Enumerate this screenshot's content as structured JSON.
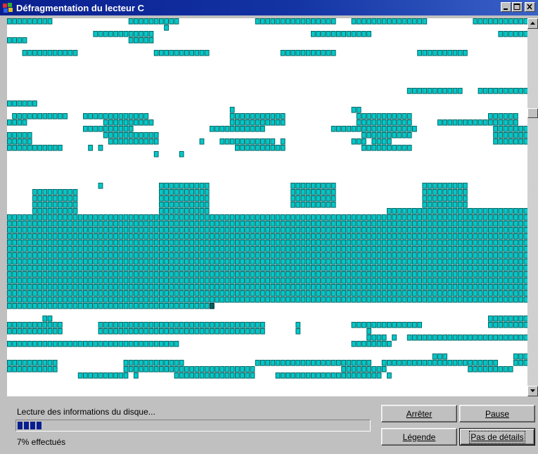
{
  "window": {
    "title": "Défragmentation du lecteur C"
  },
  "status": {
    "message": "Lecture des informations du disque...",
    "progress_text": "7% effectués",
    "progress_fraction": 0.07
  },
  "buttons": {
    "stop": "Arrêter",
    "pause": "Pause",
    "legend": "Légende",
    "details": "Pas de détails"
  },
  "colors": {
    "cluster": "#00c8c8",
    "cluster_border": "#006868",
    "current_cluster": "#006060",
    "map_background": "#ffffff"
  }
}
